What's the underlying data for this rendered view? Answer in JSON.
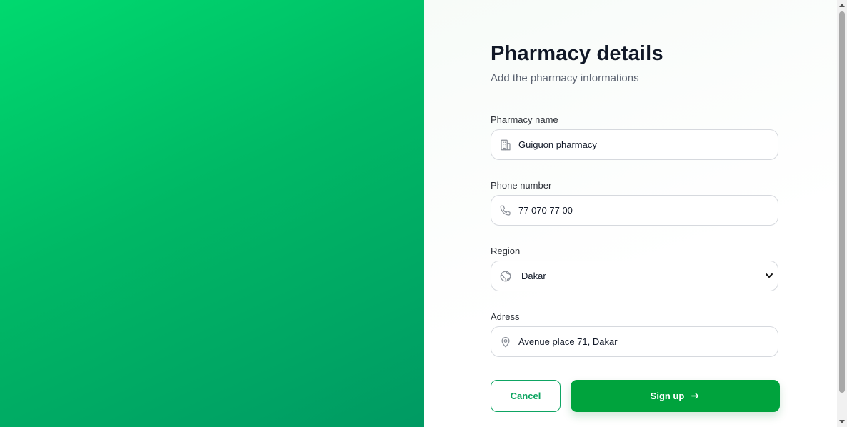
{
  "form": {
    "title": "Pharmacy details",
    "subtitle": "Add the pharmacy informations",
    "fields": [
      {
        "label": "Pharmacy name",
        "value": "Guiguon pharmacy",
        "icon": "building-icon"
      },
      {
        "label": "Phone number",
        "value": "77 070 77 00",
        "icon": "phone-icon"
      },
      {
        "label": "Region",
        "value": "Dakar",
        "icon": "globe-icon"
      },
      {
        "label": "Adress",
        "value": "Avenue place 71, Dakar",
        "icon": "map-pin-icon"
      }
    ],
    "cancel_label": "Cancel",
    "signup_label": "Sign up"
  },
  "colors": {
    "accent": "#00a33d",
    "hero_gradient_start": "#00d96f",
    "hero_gradient_end": "#009a63"
  }
}
